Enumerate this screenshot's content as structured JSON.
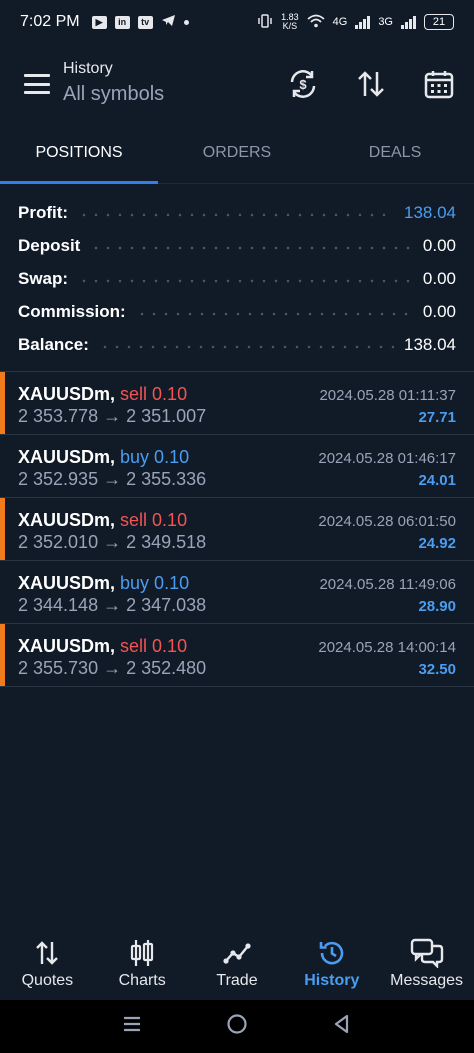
{
  "status_bar": {
    "time": "7:02 PM",
    "net_speed_value": "1.83",
    "net_speed_unit": "K/S",
    "net_4g": "4G",
    "net_3g": "3G",
    "battery": "21"
  },
  "header": {
    "title": "History",
    "subtitle": "All symbols"
  },
  "tabs": [
    {
      "label": "POSITIONS",
      "active": true
    },
    {
      "label": "ORDERS",
      "active": false
    },
    {
      "label": "DEALS",
      "active": false
    }
  ],
  "summary": {
    "profit_label": "Profit:",
    "profit_value": "138.04",
    "deposit_label": "Deposit",
    "deposit_value": "0.00",
    "swap_label": "Swap:",
    "swap_value": "0.00",
    "commission_label": "Commission:",
    "commission_value": "0.00",
    "balance_label": "Balance:",
    "balance_value": "138.04"
  },
  "deals": [
    {
      "symbol": "XAUUSDm,",
      "side": "sell 0.10",
      "prices": "2 353.778 → 2 351.007",
      "time": "2024.05.28 01:11:37",
      "profit": "27.71"
    },
    {
      "symbol": "XAUUSDm,",
      "side": "buy 0.10",
      "prices": "2 352.935 → 2 355.336",
      "time": "2024.05.28 01:46:17",
      "profit": "24.01"
    },
    {
      "symbol": "XAUUSDm,",
      "side": "sell 0.10",
      "prices": "2 352.010 → 2 349.518",
      "time": "2024.05.28 06:01:50",
      "profit": "24.92"
    },
    {
      "symbol": "XAUUSDm,",
      "side": "buy 0.10",
      "prices": "2 344.148 → 2 347.038",
      "time": "2024.05.28 11:49:06",
      "profit": "28.90"
    },
    {
      "symbol": "XAUUSDm,",
      "side": "sell 0.10",
      "prices": "2 355.730 → 2 352.480",
      "time": "2024.05.28 14:00:14",
      "profit": "32.50"
    }
  ],
  "bottom_nav": [
    {
      "label": "Quotes",
      "icon": "quotes-icon",
      "active": false
    },
    {
      "label": "Charts",
      "icon": "charts-icon",
      "active": false
    },
    {
      "label": "Trade",
      "icon": "trade-icon",
      "active": false
    },
    {
      "label": "History",
      "icon": "history-icon",
      "active": true
    },
    {
      "label": "Messages",
      "icon": "messages-icon",
      "active": false
    }
  ],
  "colors": {
    "background": "#111a27",
    "accent_blue": "#4a9df0",
    "sell_red": "#f25454",
    "sell_marker_orange": "#f07c1e"
  }
}
